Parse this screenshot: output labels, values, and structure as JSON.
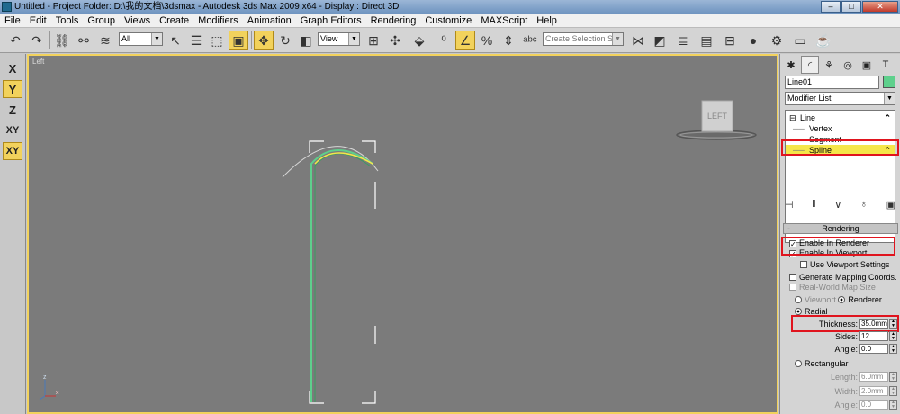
{
  "window": {
    "title": "Untitled     - Project Folder: D:\\我的文档\\3dsmax     - Autodesk 3ds Max  2009 x64     - Display : Direct 3D"
  },
  "menu": [
    "File",
    "Edit",
    "Tools",
    "Group",
    "Views",
    "Create",
    "Modifiers",
    "Animation",
    "Graph Editors",
    "Rendering",
    "Customize",
    "MAXScript",
    "Help"
  ],
  "toolbar": {
    "filter": "All",
    "refcoord": "View",
    "named_sel": "Create Selection Set"
  },
  "axes": [
    "X",
    "Y",
    "Z",
    "XY",
    "XY"
  ],
  "viewport": {
    "label": "Left",
    "viewcube": "LEFT",
    "gizmo_z": "z",
    "gizmo_x": "x"
  },
  "panel": {
    "object_name": "Line01",
    "modifier_list": "Modifier List",
    "stack": {
      "root": "Line",
      "items": [
        "Vertex",
        "Segment",
        "Spline"
      ]
    },
    "rollout": "Rendering",
    "enable_renderer": "Enable In Renderer",
    "enable_viewport": "Enable In Viewport",
    "use_viewport": "Use Viewport Settings",
    "gen_mapping": "Generate Mapping Coords.",
    "real_world": "Real-World Map Size",
    "viewport_opt": "Viewport",
    "renderer_opt": "Renderer",
    "radial": "Radial",
    "thickness_label": "Thickness:",
    "thickness": "35.0mm",
    "sides_label": "Sides:",
    "sides": "12",
    "angle_label": "Angle:",
    "angle": "0.0",
    "rectangular": "Rectangular",
    "length_label": "Length:",
    "length": "6.0mm",
    "width_label": "Width:",
    "width": "2.0mm",
    "angle2_label": "Angle:",
    "angle2": "0.0"
  },
  "colors": {
    "highlight": "#f5e64a",
    "spline": "#5ed08c",
    "annotation": "#e0141e"
  }
}
